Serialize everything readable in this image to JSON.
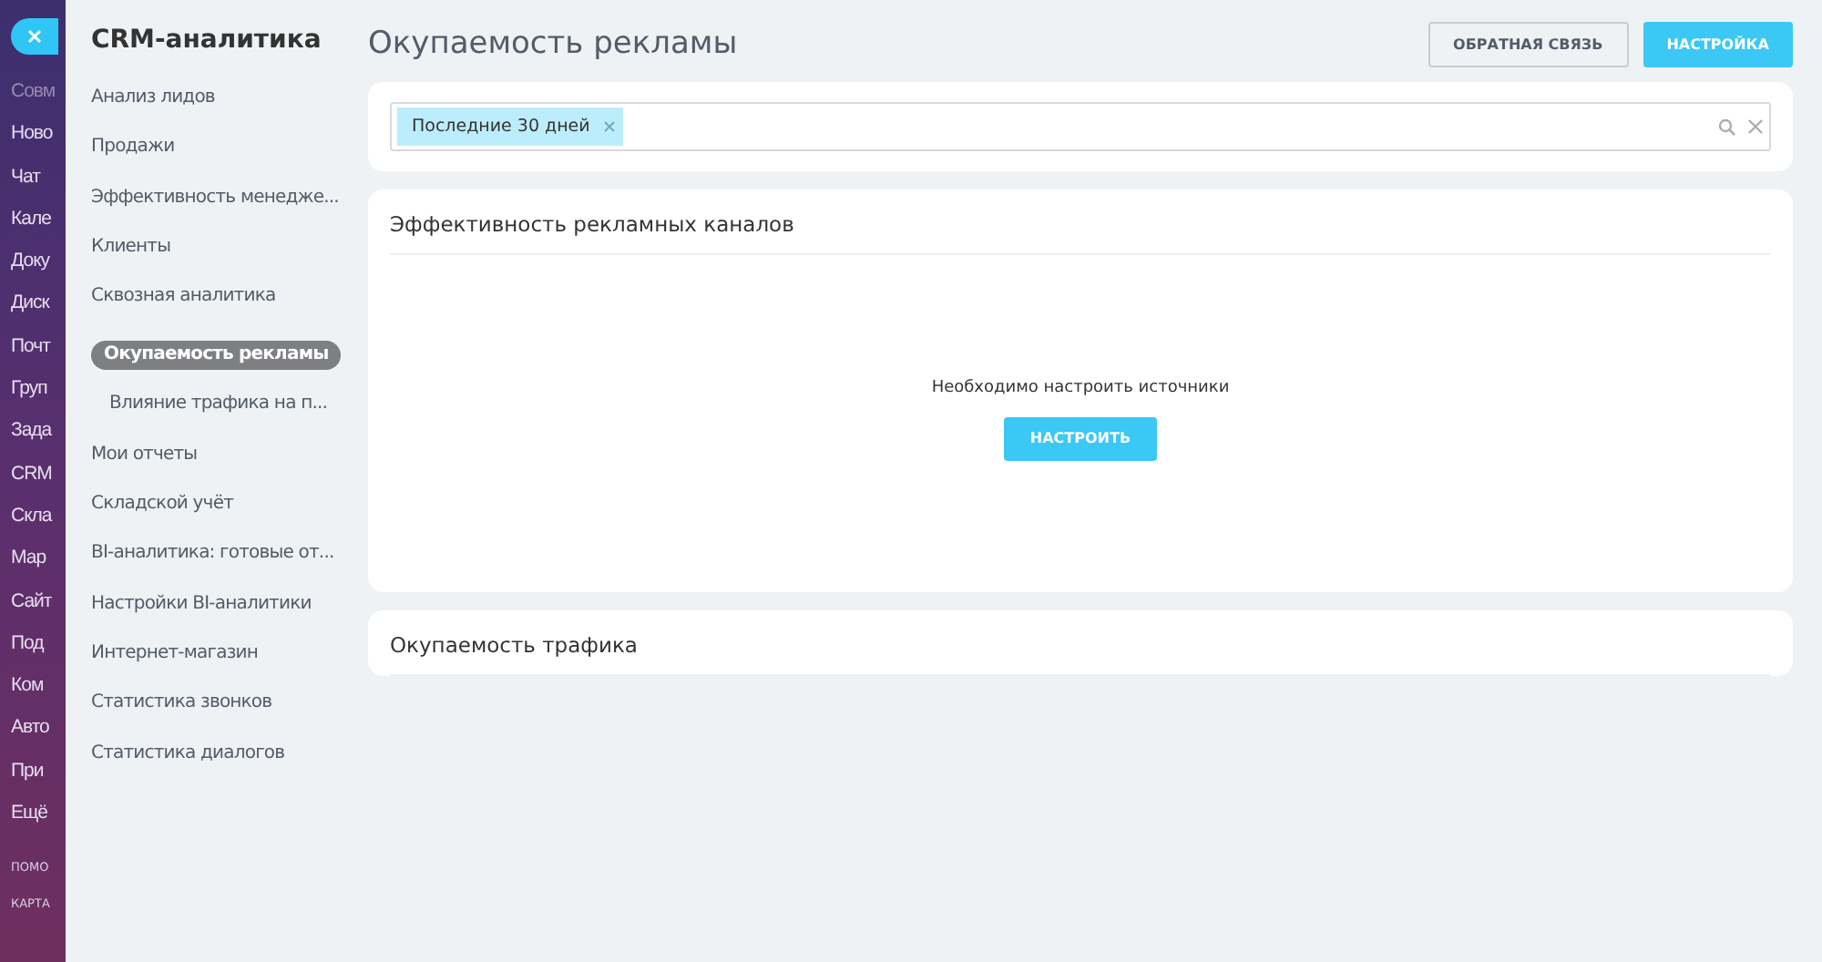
{
  "back_menu": {
    "items": [
      "Совм",
      "Ново",
      "Чат",
      "Кале",
      "Доку",
      "Диск",
      "Почт",
      "Груп",
      "Зада",
      "CRM",
      "Скла",
      "Мар",
      "Сайт",
      "Под",
      "Ком",
      "Авто",
      "При",
      "Ещё"
    ],
    "footer": [
      "ПОМО",
      "КАРТА"
    ]
  },
  "sidebar": {
    "title": "CRM-аналитика",
    "items": [
      {
        "label": "Анализ лидов",
        "selected": false
      },
      {
        "label": "Продажи",
        "selected": false
      },
      {
        "label": "Эффективность менедже...",
        "selected": false
      },
      {
        "label": "Клиенты",
        "selected": false
      },
      {
        "label": "Сквозная аналитика",
        "selected": false,
        "children": [
          {
            "label": "Окупаемость рекламы",
            "selected": true,
            "children": [
              {
                "label": "Влияние трафика на п...",
                "selected": false
              }
            ]
          }
        ]
      },
      {
        "label": "Мои отчеты",
        "selected": false
      },
      {
        "label": "Складской учёт",
        "selected": false
      },
      {
        "label": "BI-аналитика: готовые от...",
        "selected": false
      },
      {
        "label": "Настройки BI-аналитики",
        "selected": false
      },
      {
        "label": "Интернет-магазин",
        "selected": false
      },
      {
        "label": "Статистика звонков",
        "selected": false
      },
      {
        "label": "Статистика диалогов",
        "selected": false
      }
    ]
  },
  "page_title": "Окупаемость рекламы",
  "buttons": [
    {
      "label": "ОБРАТНАЯ СВЯЗЬ",
      "kind": "secondary"
    },
    {
      "label": "НАСТРОЙКА",
      "kind": "primary"
    }
  ],
  "filter": {
    "tags": [
      "Последние 30 дней"
    ]
  },
  "sections": [
    {
      "title": "Эффективность рекламных каналов",
      "message": "Необходимо настроить источники",
      "action": "НАСТРОИТЬ"
    },
    {
      "title": "Окупаемость трафика"
    }
  ]
}
